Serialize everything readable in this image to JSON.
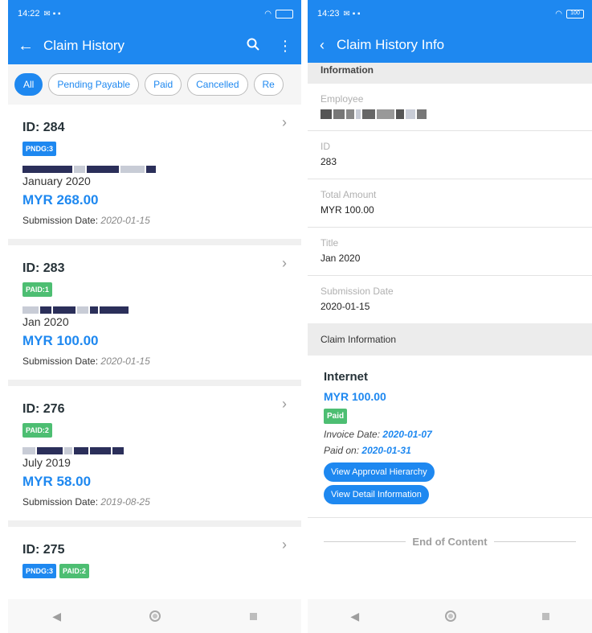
{
  "left": {
    "status": {
      "time": "14:22"
    },
    "appbar": {
      "title": "Claim History"
    },
    "chips": [
      "All",
      "Pending Payable",
      "Paid",
      "Cancelled",
      "Re"
    ],
    "claims": [
      {
        "id": "ID: 284",
        "badges": [
          "PNDG:3"
        ],
        "period": "January 2020",
        "amount": "MYR 268.00",
        "submission_label": "Submission Date:",
        "submission_date": "2020-01-15"
      },
      {
        "id": "ID: 283",
        "badges": [
          "PAID:1"
        ],
        "period": "Jan 2020",
        "amount": "MYR 100.00",
        "submission_label": "Submission Date:",
        "submission_date": "2020-01-15"
      },
      {
        "id": "ID: 276",
        "badges": [
          "PAID:2"
        ],
        "period": "July 2019",
        "amount": "MYR 58.00",
        "submission_label": "Submission Date:",
        "submission_date": "2019-08-25"
      },
      {
        "id": "ID: 275",
        "badges": [
          "PNDG:3",
          "PAID:2"
        ]
      }
    ]
  },
  "right": {
    "status": {
      "time": "14:23",
      "battery": "100"
    },
    "appbar": {
      "title": "Claim History Info"
    },
    "info_header": "Information",
    "fields": [
      {
        "label": "Employee",
        "value": ""
      },
      {
        "label": "ID",
        "value": "283"
      },
      {
        "label": "Total Amount",
        "value": "MYR 100.00"
      },
      {
        "label": "Title",
        "value": "Jan 2020"
      },
      {
        "label": "Submission Date",
        "value": "2020-01-15"
      }
    ],
    "claim_header": "Claim Information",
    "claim": {
      "title": "Internet",
      "amount": "MYR 100.00",
      "status_badge": "Paid",
      "invoice_label": "Invoice Date:",
      "invoice_date": "2020-01-07",
      "paid_label": "Paid on:",
      "paid_date": "2020-01-31",
      "btn_hierarchy": "View Approval Hierarchy",
      "btn_detail": "View Detail Information"
    },
    "end_text": "End of Content"
  },
  "colors": {
    "primary": "#1e88f0",
    "pending": "#1e88f0",
    "paid": "#4dbe72"
  },
  "icons": [
    "back-arrow-icon",
    "search-icon",
    "more-vert-icon",
    "chevron-right-icon",
    "nav-back-icon",
    "nav-home-icon",
    "nav-recents-icon"
  ]
}
